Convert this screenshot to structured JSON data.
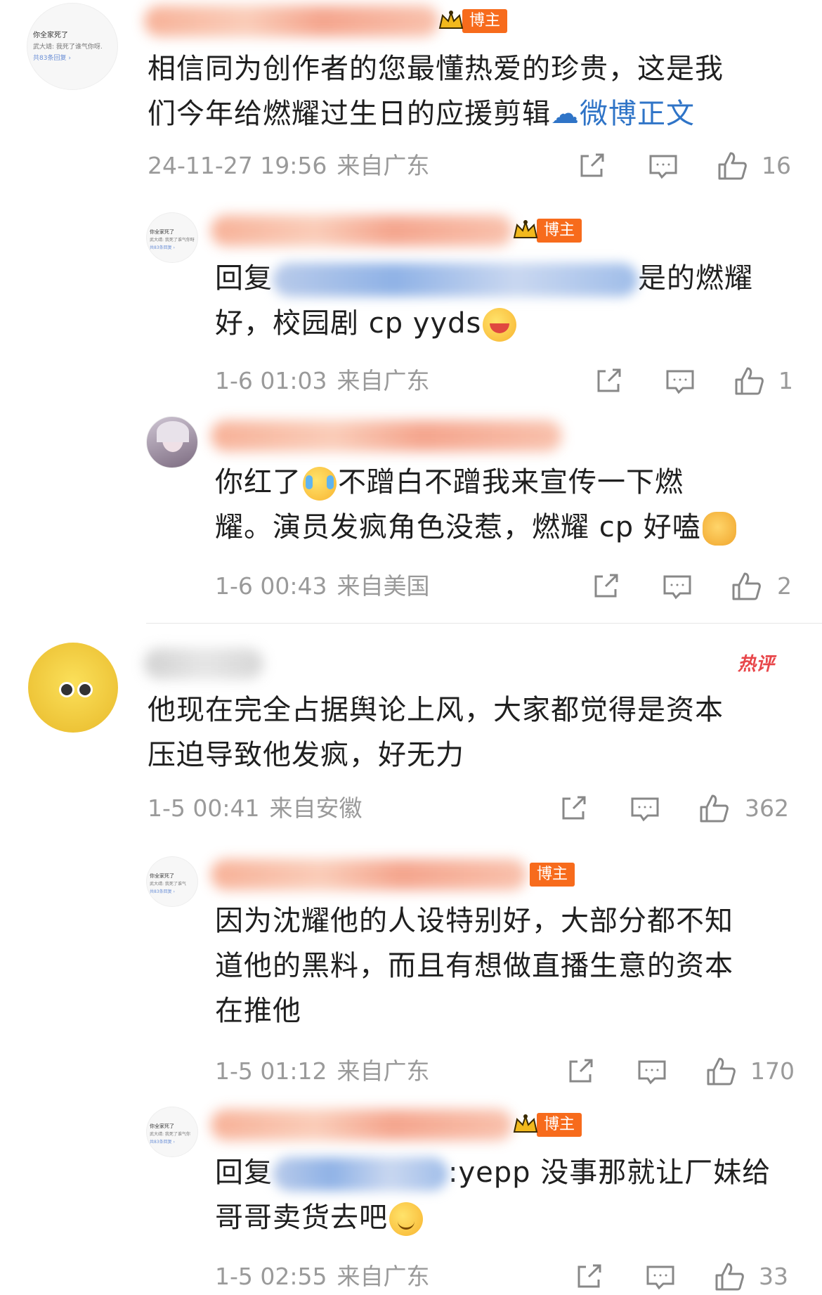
{
  "badge_label": "博主",
  "hot_label": "热评",
  "comments": [
    {
      "avatar_lines": [
        "你全家死了",
        "武大靖: 我死了谁气你呀.",
        "共83条回复 ›"
      ],
      "text_lines": [
        "相信同为创作者的您最懂热爱的珍贵，这是我",
        "们今年给燃耀过生日的应援剪辑"
      ],
      "link_text": "微博正文",
      "date": "24-11-27 19:56",
      "location": "来自广东",
      "likes": "16"
    },
    {
      "avatar_lines": [
        "你全家死了",
        "武大靖: 我死了谁气你呀",
        "共83条回复 ›"
      ],
      "reply_prefix": "回复",
      "text_line1_tail": "是的燃耀",
      "text_line2": "好，校园剧 cp yyds",
      "date": "1-6 01:03",
      "location": "来自广东",
      "likes": "1"
    },
    {
      "text_line1_a": "你红了",
      "text_line1_b": "不蹭白不蹭我来宣传一下燃",
      "text_line2": "耀。演员发疯角色没惹，燃耀 cp 好嗑",
      "date": "1-6 00:43",
      "location": "来自美国",
      "likes": "2"
    },
    {
      "text_lines": [
        "他现在完全占据舆论上风，大家都觉得是资本",
        "压迫导致他发疯，好无力"
      ],
      "date": "1-5 00:41",
      "location": "来自安徽",
      "likes": "362"
    },
    {
      "avatar_lines": [
        "你全家死了",
        "武大靖: 我死了谁气",
        "共83条回复 ›"
      ],
      "text_lines": [
        "因为沈耀他的人设特别好，大部分都不知",
        "道他的黑料，而且有想做直播生意的资本",
        "在推他"
      ],
      "date": "1-5 01:12",
      "location": "来自广东",
      "likes": "170"
    },
    {
      "avatar_lines": [
        "你全家死了",
        "武大靖: 我死了谁气你",
        "共83条回复 ›"
      ],
      "reply_prefix": "回复",
      "text_line1_tail": ":yepp 没事那就让厂妹给",
      "text_line2": "哥哥卖货去吧",
      "date": "1-5 02:55",
      "location": "来自广东",
      "likes": "33"
    }
  ]
}
